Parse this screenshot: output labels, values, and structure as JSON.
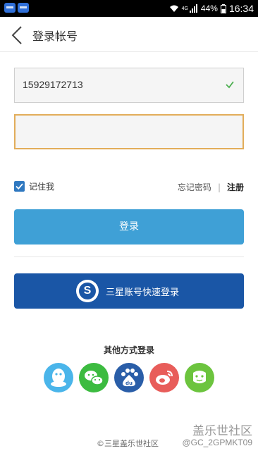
{
  "status_bar": {
    "network": "4G",
    "battery": "44%",
    "time": "16:34"
  },
  "header": {
    "title": "登录帐号"
  },
  "form": {
    "phone_value": "15929172713",
    "password_value": "",
    "remember_label": "记住我",
    "remember_checked": true,
    "forgot_password": "忘记密码",
    "separator": "|",
    "register": "注册"
  },
  "buttons": {
    "login": "登录",
    "samsung_login": "三星账号快速登录",
    "samsung_icon_letter": "S"
  },
  "other_login": {
    "title": "其他方式登录",
    "providers": [
      {
        "name": "qq-icon",
        "color": "#4ab5ea"
      },
      {
        "name": "wechat-icon",
        "color": "#3cbb40"
      },
      {
        "name": "baidu-icon",
        "color": "#2a5ea8"
      },
      {
        "name": "weibo-icon",
        "color": "#e85d5a"
      },
      {
        "name": "other-login-icon",
        "color": "#6cc43e"
      }
    ]
  },
  "footer": {
    "copyright": "©三星盖乐世社区",
    "watermark_brand": "盖乐世社区",
    "watermark_user": "@GC_2GPMKT09"
  },
  "colors": {
    "login_button": "#3fa0d6",
    "samsung_button": "#1a56a6",
    "password_focus": "#e2ad5a",
    "checkbox": "#2f78c0"
  }
}
